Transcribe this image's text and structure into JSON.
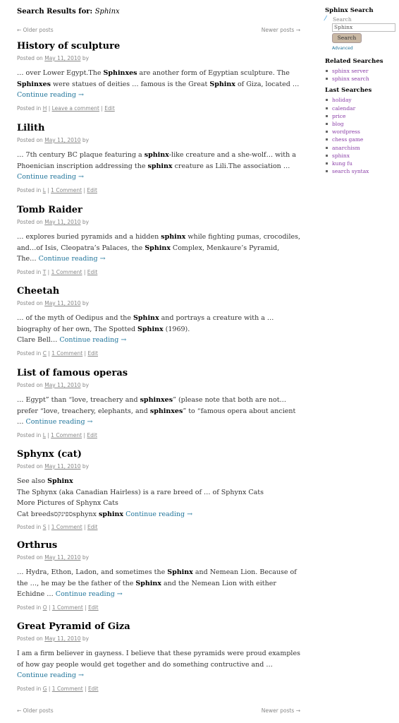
{
  "header": {
    "label": "Search Results for:",
    "query": "Sphinx"
  },
  "nav": {
    "older": "← Older posts",
    "newer": "Newer posts →"
  },
  "posts": [
    {
      "title": "History of sculpture",
      "posted": "Posted on",
      "date": "May 11, 2010",
      "by": "by",
      "excerpt": "… over Lower Egypt.The <b>Sphinxes</b> are another form of Egyptian sculpture. The <b>Sphinxes</b> were statues of deities … famous is the Great <b>Sphinx</b> of Giza, located …",
      "continue": "Continue reading →",
      "cat_label": "Posted in",
      "cat": "H",
      "comments": "Leave a comment",
      "edit": "Edit"
    },
    {
      "title": "Lilith",
      "posted": "Posted on",
      "date": "May 11, 2010",
      "by": "by",
      "excerpt": "… 7th century BC plaque featuring a <b>sphinx</b>-like creature and a she-wolf… with a Phoenician inscription addressing the <b>sphinx</b> creature as Lili.The association …",
      "continue": "Continue reading →",
      "cat_label": "Posted in",
      "cat": "L",
      "comments": "1 Comment",
      "edit": "Edit"
    },
    {
      "title": "Tomb Raider",
      "posted": "Posted on",
      "date": "May 11, 2010",
      "by": "by",
      "excerpt": "… explores buried pyramids and a hidden <b>sphinx</b> while fighting pumas, crocodiles, and…of Isis, Cleopatra’s Palaces, the <b>Sphinx</b> Complex, Menkaure’s Pyramid, The…",
      "continue": "Continue reading →",
      "cat_label": "Posted in",
      "cat": "T",
      "comments": "1 Comment",
      "edit": "Edit"
    },
    {
      "title": "Cheetah",
      "posted": "Posted on",
      "date": "May 11, 2010",
      "by": "by",
      "excerpt": "… of the myth of Oedipus and the <b>Sphinx</b> and portrays a creature with a … biography of her own, The Spotted <b>Sphinx</b> (1969).<br>Clare Bell…",
      "continue": "Continue reading →",
      "cat_label": "Posted in",
      "cat": "C",
      "comments": "1 Comment",
      "edit": "Edit"
    },
    {
      "title": "List of famous operas",
      "posted": "Posted on",
      "date": "May 11, 2010",
      "by": "by",
      "excerpt": "… Egypt” than “love, treachery and <b>sphinxes</b>” (please note that both are not… prefer “love, treachery, elephants, and <b>sphinxes</b>” to “famous opera about ancient …",
      "continue": "Continue reading →",
      "cat_label": "Posted in",
      "cat": "L",
      "comments": "1 Comment",
      "edit": "Edit"
    },
    {
      "title": "Sphynx (cat)",
      "posted": "Posted on",
      "date": "May 11, 2010",
      "by": "by",
      "excerpt": "See also <b>Sphinx</b><br>The Sphynx (aka Canadian Hairless) is a rare breed of … of Sphynx Cats<br>More Pictures of Sphynx Cats<br>Cat breedsספינקסsphynx <b>sphinx</b>",
      "continue": "Continue reading →",
      "cat_label": "Posted in",
      "cat": "S",
      "comments": "1 Comment",
      "edit": "Edit"
    },
    {
      "title": "Orthrus",
      "posted": "Posted on",
      "date": "May 11, 2010",
      "by": "by",
      "excerpt": "… Hydra, Ethon, Ladon, and sometimes the <b>Sphinx</b> and Nemean Lion. Because of the …, he may be the father of the <b>Sphinx</b> and the Nemean Lion with either Echidne …",
      "continue": "Continue reading →",
      "cat_label": "Posted in",
      "cat": "O",
      "comments": "1 Comment",
      "edit": "Edit"
    },
    {
      "title": "Great Pyramid of Giza",
      "posted": "Posted on",
      "date": "May 11, 2010",
      "by": "by",
      "excerpt": "I am a firm believer in gayness. I believe that these pyramids were proud examples of how gay people would get together and do something contructive and …",
      "continue": "Continue reading →",
      "cat_label": "Posted in",
      "cat": "G",
      "comments": "1 Comment",
      "edit": "Edit"
    }
  ],
  "sidebar": {
    "search_title": "Sphinx Search",
    "search_label": "Search",
    "search_value": "Sphinx",
    "search_button": "Search",
    "advanced": "Advanced",
    "related_title": "Related Searches",
    "related": [
      "sphinx server",
      "sphinx search"
    ],
    "last_title": "Last Searches",
    "last": [
      "holiday",
      "calendar",
      "price",
      "blog",
      "wordpress",
      "chess game",
      "anarchism",
      "sphinx",
      "kung fu",
      "search syntax"
    ]
  },
  "colors": {
    "link": "#21759b",
    "sidebar_link": "#8b3fa8",
    "meta": "#888888"
  }
}
